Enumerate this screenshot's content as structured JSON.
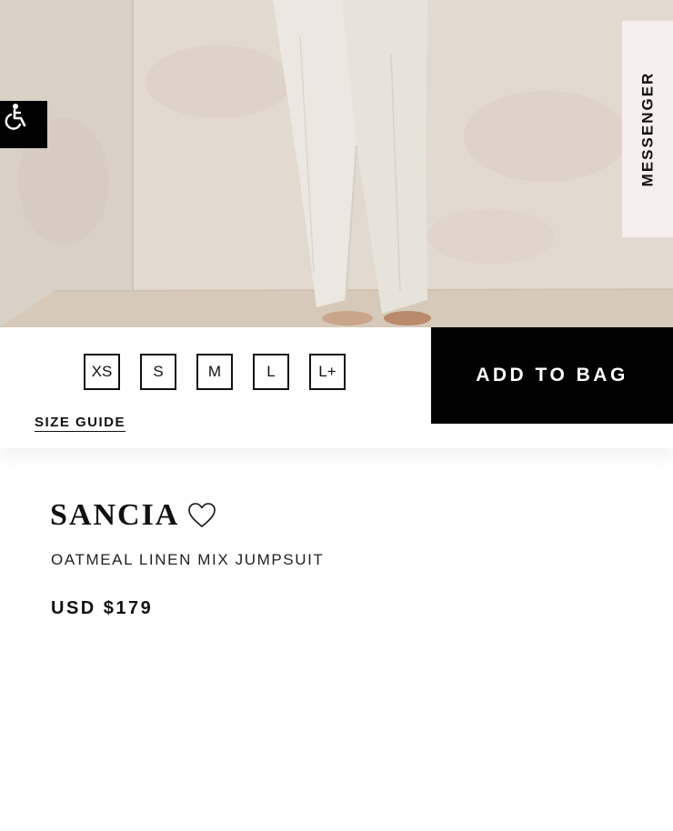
{
  "hero": {
    "image_icon": "product-photo-legs-in-linen-trousers",
    "accessibility_icon": "wheelchair-accessibility-icon",
    "messenger_label": "MESSENGER"
  },
  "purchase": {
    "sizes": [
      "XS",
      "S",
      "M",
      "L",
      "L+"
    ],
    "size_guide_label": "SIZE GUIDE",
    "add_to_bag_label": "ADD TO BAG"
  },
  "product": {
    "name": "SANCIA",
    "favorite_icon": "heart-outline-icon",
    "description": "OATMEAL LINEN MIX JUMPSUIT",
    "price": "USD $179"
  },
  "colors": {
    "accent": "#000000",
    "messenger_bg": "#f7eeee",
    "hero_wall": "#ddd3c9"
  }
}
